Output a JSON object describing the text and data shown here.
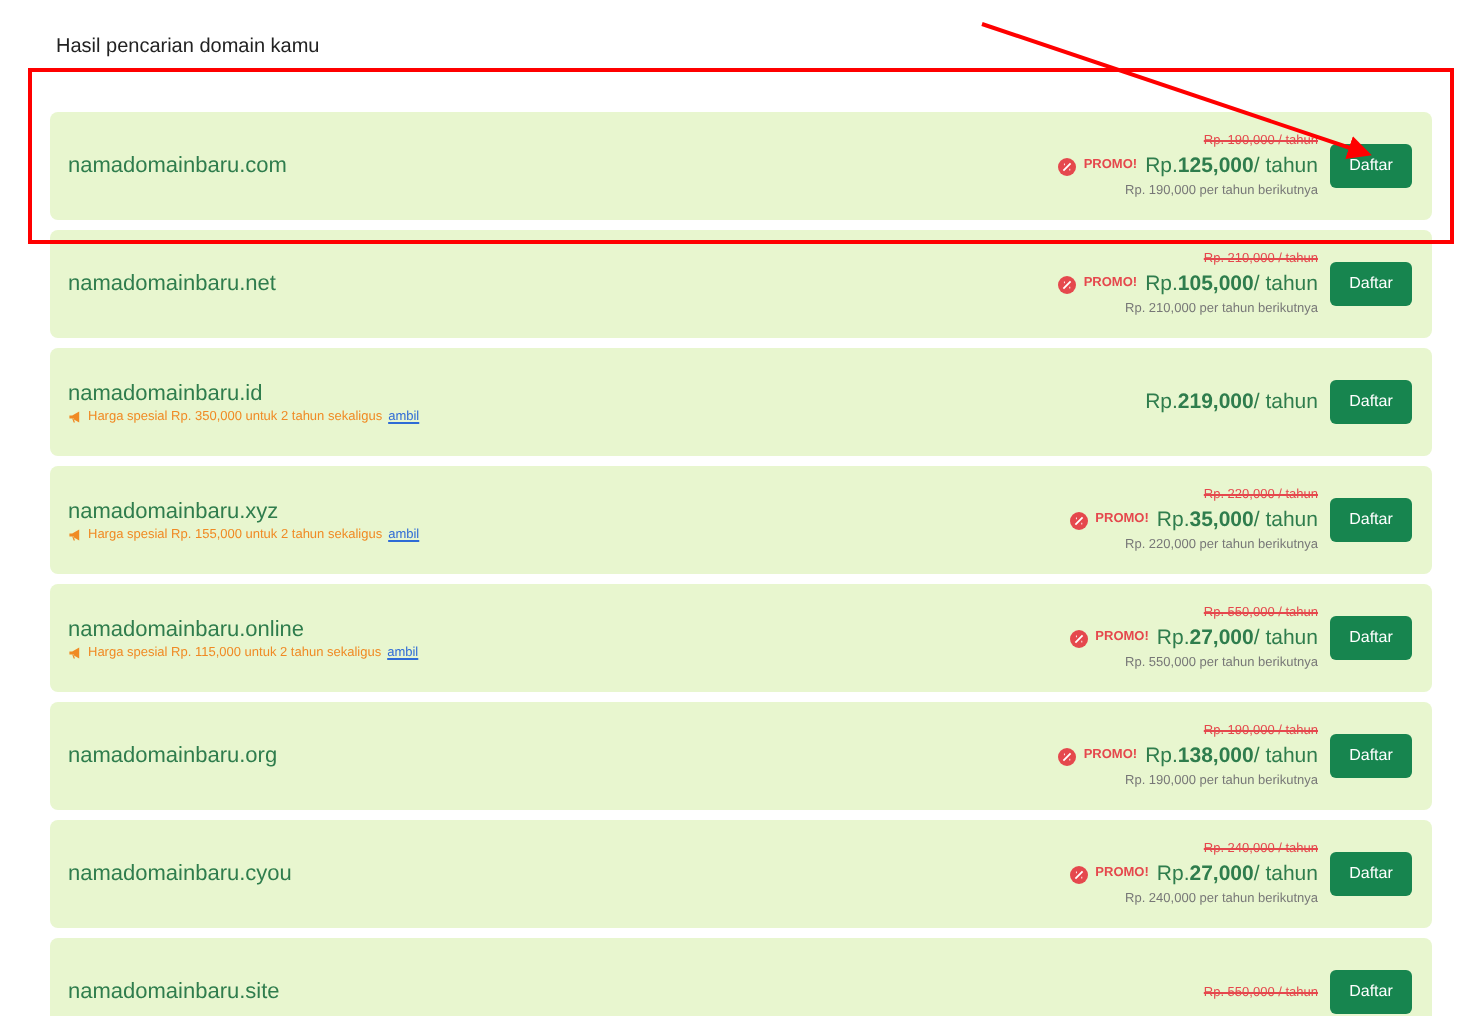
{
  "heading": "Hasil pencarian domain kamu",
  "results": [
    {
      "domain": "namadomainbaru.com",
      "old_price": "Rp. 190,000 / tahun",
      "promo": "PROMO!",
      "price": "Rp.**125,000**/ tahun",
      "renewal": "Rp. 190,000 per tahun berikutnya",
      "button": "Daftar"
    },
    {
      "domain": "namadomainbaru.net",
      "old_price": "Rp. 210,000 / tahun",
      "promo": "PROMO!",
      "price": "Rp.**105,000**/ tahun",
      "renewal": "Rp. 210,000 per tahun berikutnya",
      "button": "Daftar"
    },
    {
      "domain": "namadomainbaru.id",
      "offer": "Harga spesial Rp. 350,000 untuk 2 tahun sekaligus",
      "offer_link": "ambil",
      "price": "Rp.**219,000**/ tahun",
      "button": "Daftar"
    },
    {
      "domain": "namadomainbaru.xyz",
      "offer": "Harga spesial Rp. 155,000 untuk 2 tahun sekaligus",
      "offer_link": "ambil",
      "old_price": "Rp. 220,000 / tahun",
      "promo": "PROMO!",
      "price": "Rp.**35,000**/ tahun",
      "renewal": "Rp. 220,000 per tahun berikutnya",
      "button": "Daftar"
    },
    {
      "domain": "namadomainbaru.online",
      "offer": "Harga spesial Rp. 115,000 untuk 2 tahun sekaligus",
      "offer_link": "ambil",
      "old_price": "Rp. 550,000 / tahun",
      "promo": "PROMO!",
      "price": "Rp.**27,000**/ tahun",
      "renewal": "Rp. 550,000 per tahun berikutnya",
      "button": "Daftar"
    },
    {
      "domain": "namadomainbaru.org",
      "old_price": "Rp. 190,000 / tahun",
      "promo": "PROMO!",
      "price": "Rp.**138,000**/ tahun",
      "renewal": "Rp. 190,000 per tahun berikutnya",
      "button": "Daftar"
    },
    {
      "domain": "namadomainbaru.cyou",
      "old_price": "Rp. 240,000 / tahun",
      "promo": "PROMO!",
      "price": "Rp.**27,000**/ tahun",
      "renewal": "Rp. 240,000 per tahun berikutnya",
      "button": "Daftar"
    },
    {
      "domain": "namadomainbaru.site",
      "old_price": "Rp. 550,000 / tahun",
      "button": "Daftar"
    }
  ]
}
